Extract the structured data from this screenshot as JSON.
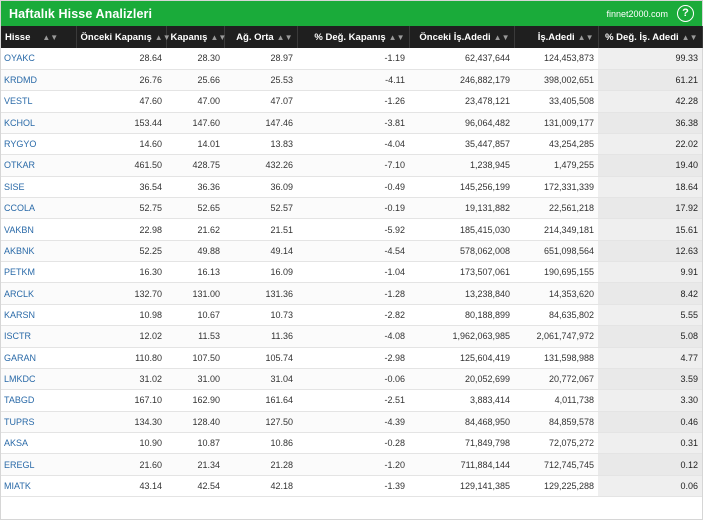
{
  "header": {
    "title": "Haftalık Hisse Analizleri",
    "brand": "finnet2000.com",
    "help": "?"
  },
  "columns": [
    "Hisse",
    "Önceki Kapanış",
    "Kapanış",
    "Ağ. Orta",
    "% Değ. Kapanış",
    "Önceki İş.Adedi",
    "İş.Adedi",
    "% Değ. İş. Adedi"
  ],
  "sort_glyph": "▲▼",
  "rows": [
    [
      "OYAKC",
      "28.64",
      "28.30",
      "28.97",
      "-1.19",
      "62,437,644",
      "124,453,873",
      "99.33"
    ],
    [
      "KRDMD",
      "26.76",
      "25.66",
      "25.53",
      "-4.11",
      "246,882,179",
      "398,002,651",
      "61.21"
    ],
    [
      "VESTL",
      "47.60",
      "47.00",
      "47.07",
      "-1.26",
      "23,478,121",
      "33,405,508",
      "42.28"
    ],
    [
      "KCHOL",
      "153.44",
      "147.60",
      "147.46",
      "-3.81",
      "96,064,482",
      "131,009,177",
      "36.38"
    ],
    [
      "RYGYO",
      "14.60",
      "14.01",
      "13.83",
      "-4.04",
      "35,447,857",
      "43,254,285",
      "22.02"
    ],
    [
      "OTKAR",
      "461.50",
      "428.75",
      "432.26",
      "-7.10",
      "1,238,945",
      "1,479,255",
      "19.40"
    ],
    [
      "SISE",
      "36.54",
      "36.36",
      "36.09",
      "-0.49",
      "145,256,199",
      "172,331,339",
      "18.64"
    ],
    [
      "CCOLA",
      "52.75",
      "52.65",
      "52.57",
      "-0.19",
      "19,131,882",
      "22,561,218",
      "17.92"
    ],
    [
      "VAKBN",
      "22.98",
      "21.62",
      "21.51",
      "-5.92",
      "185,415,030",
      "214,349,181",
      "15.61"
    ],
    [
      "AKBNK",
      "52.25",
      "49.88",
      "49.14",
      "-4.54",
      "578,062,008",
      "651,098,564",
      "12.63"
    ],
    [
      "PETKM",
      "16.30",
      "16.13",
      "16.09",
      "-1.04",
      "173,507,061",
      "190,695,155",
      "9.91"
    ],
    [
      "ARCLK",
      "132.70",
      "131.00",
      "131.36",
      "-1.28",
      "13,238,840",
      "14,353,620",
      "8.42"
    ],
    [
      "KARSN",
      "10.98",
      "10.67",
      "10.73",
      "-2.82",
      "80,188,899",
      "84,635,802",
      "5.55"
    ],
    [
      "ISCTR",
      "12.02",
      "11.53",
      "11.36",
      "-4.08",
      "1,962,063,985",
      "2,061,747,972",
      "5.08"
    ],
    [
      "GARAN",
      "110.80",
      "107.50",
      "105.74",
      "-2.98",
      "125,604,419",
      "131,598,988",
      "4.77"
    ],
    [
      "LMKDC",
      "31.02",
      "31.00",
      "31.04",
      "-0.06",
      "20,052,699",
      "20,772,067",
      "3.59"
    ],
    [
      "TABGD",
      "167.10",
      "162.90",
      "161.64",
      "-2.51",
      "3,883,414",
      "4,011,738",
      "3.30"
    ],
    [
      "TUPRS",
      "134.30",
      "128.40",
      "127.50",
      "-4.39",
      "84,468,950",
      "84,859,578",
      "0.46"
    ],
    [
      "AKSA",
      "10.90",
      "10.87",
      "10.86",
      "-0.28",
      "71,849,798",
      "72,075,272",
      "0.31"
    ],
    [
      "EREGL",
      "21.60",
      "21.34",
      "21.28",
      "-1.20",
      "711,884,144",
      "712,745,745",
      "0.12"
    ],
    [
      "MIATK",
      "43.14",
      "42.54",
      "42.18",
      "-1.39",
      "129,141,385",
      "129,225,288",
      "0.06"
    ]
  ],
  "colors": {
    "header_bg": "#1aab3a",
    "thead_bg": "#1f1f1f",
    "symbol": "#2a6aa8"
  }
}
